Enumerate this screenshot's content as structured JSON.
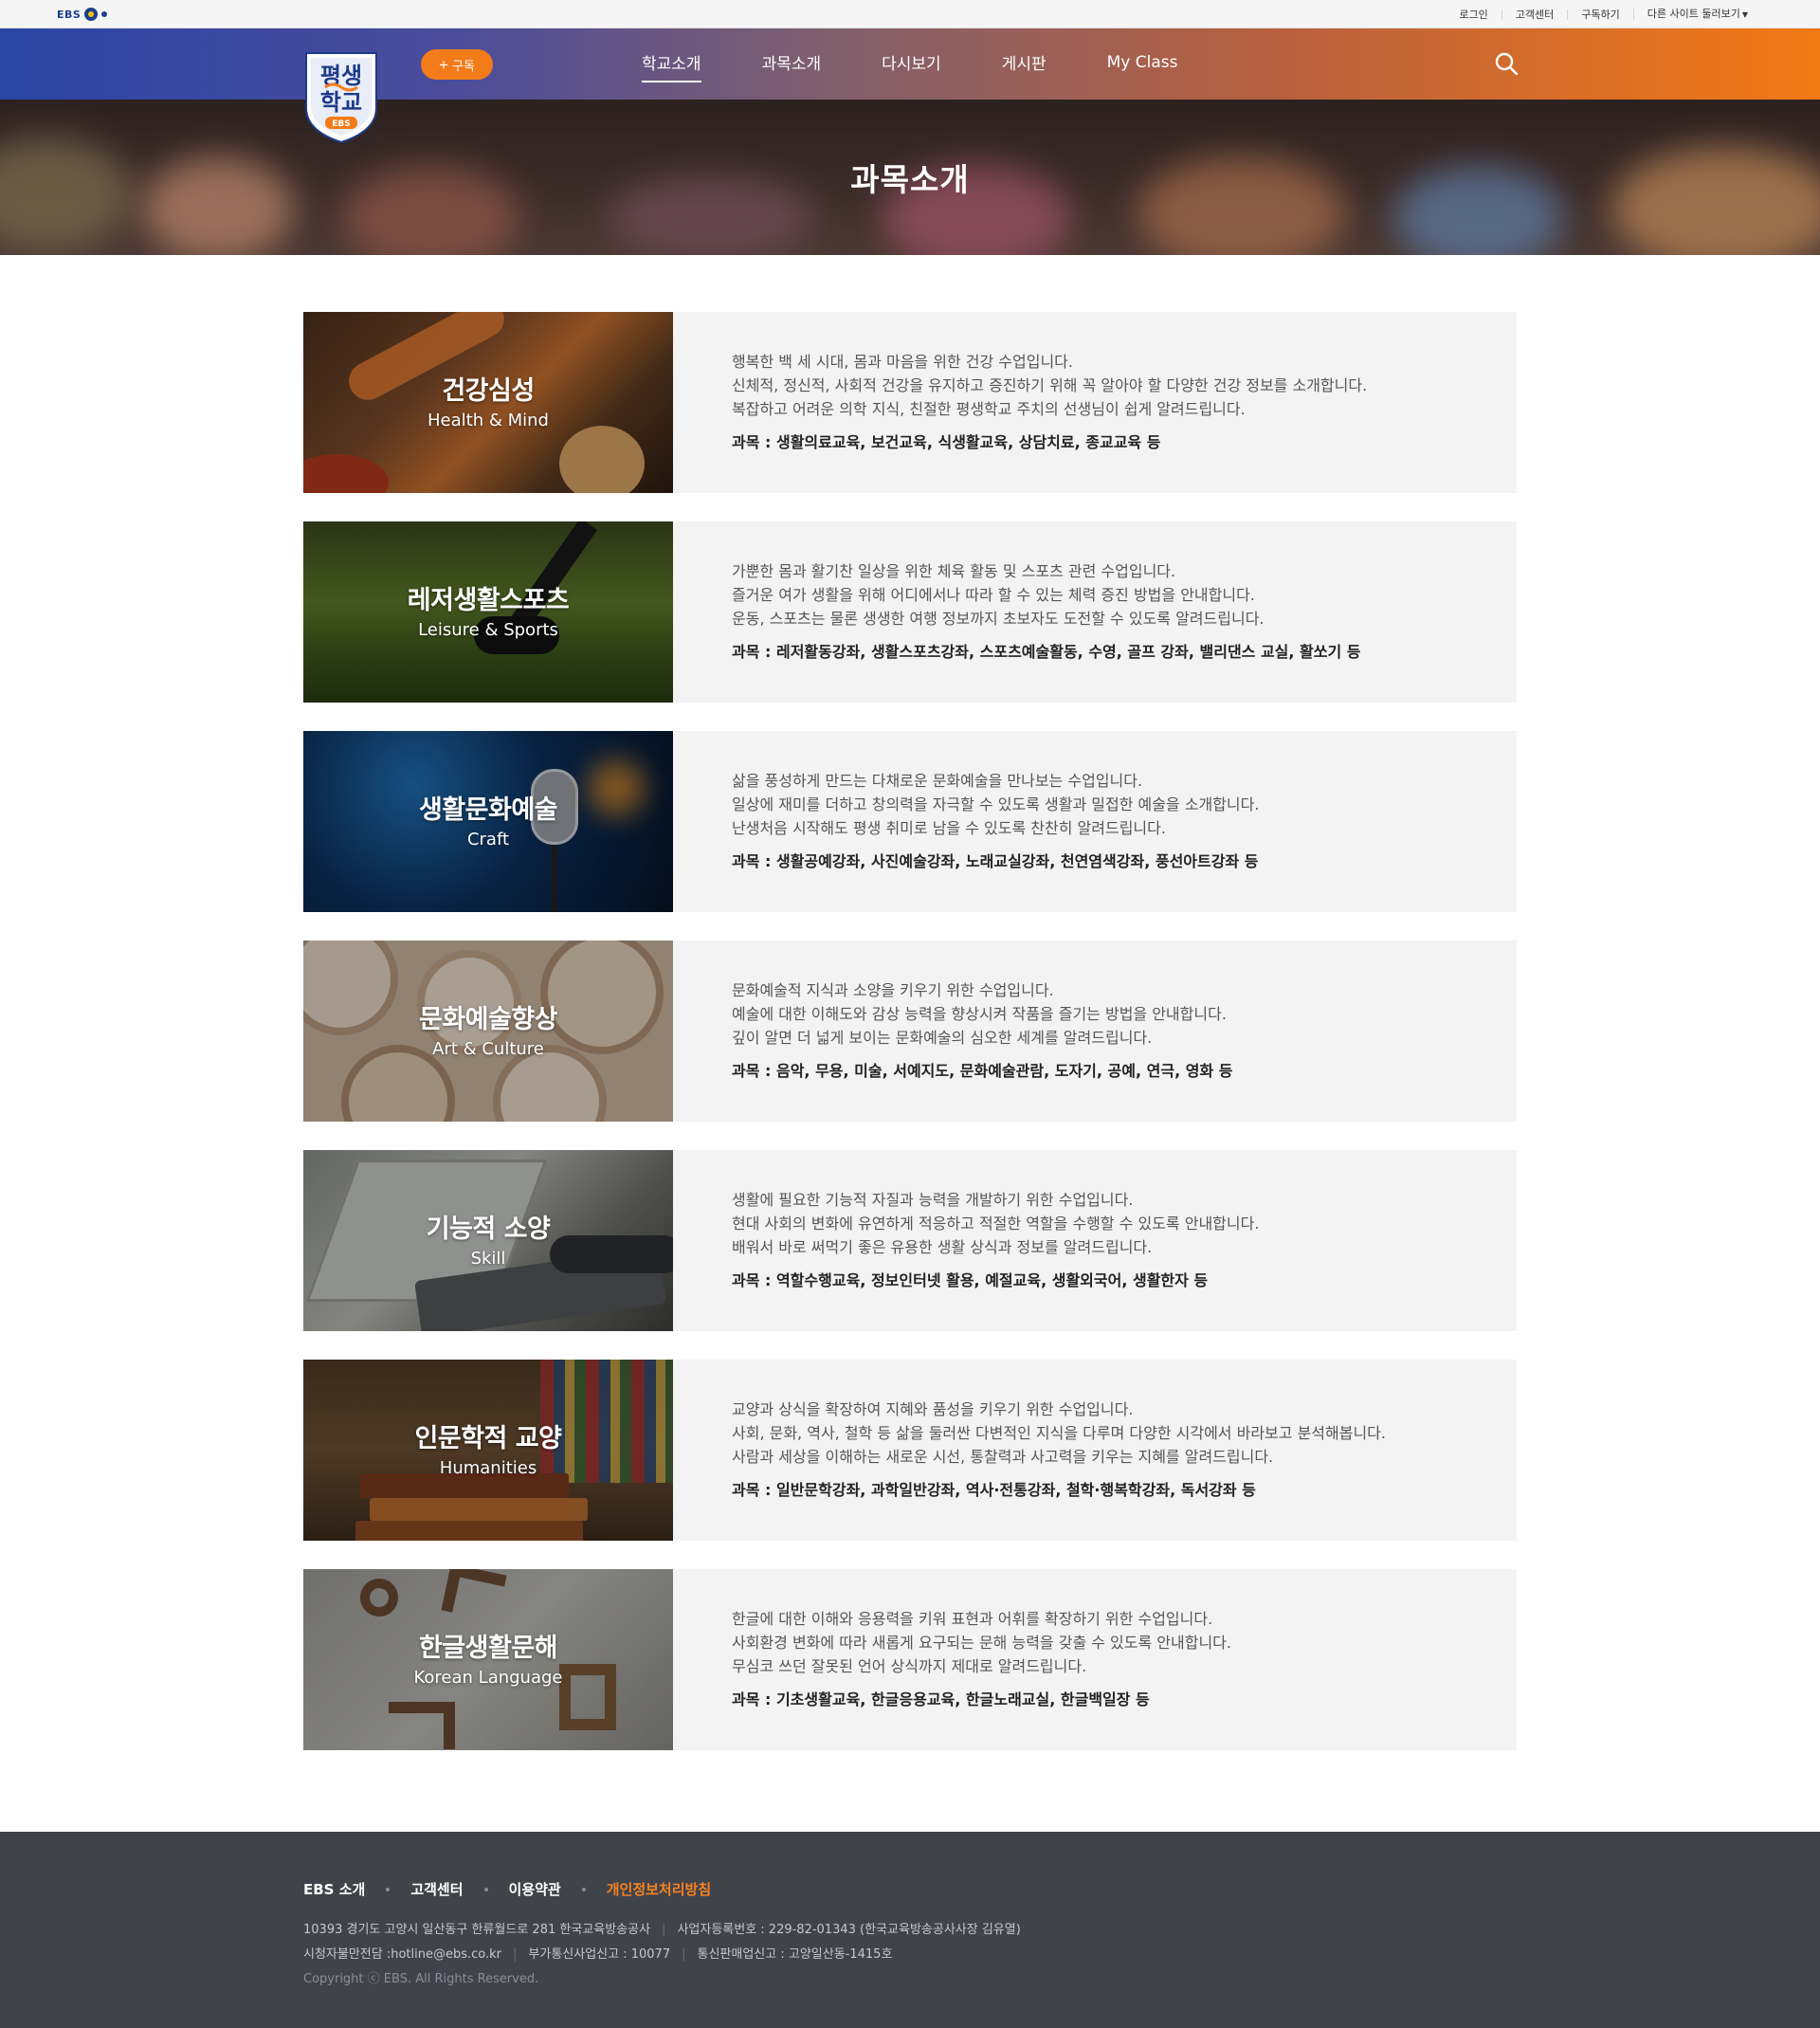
{
  "util": {
    "brand": "EBS",
    "links": [
      "로그인",
      "고객센터",
      "구독하기",
      "다른 사이트 둘러보기"
    ]
  },
  "header": {
    "logo_text_line1": "평생",
    "logo_text_line2": "학교",
    "logo_badge": "EBS",
    "subscribe_label": "구독",
    "nav": [
      "학교소개",
      "과목소개",
      "다시보기",
      "게시판",
      "My Class"
    ],
    "active_nav": "학교소개"
  },
  "hero": {
    "title": "과목소개"
  },
  "subjects": [
    {
      "title_ko": "건강심성",
      "title_en": "Health & Mind",
      "lines": [
        "행복한 백 세 시대, 몸과 마음을 위한 건강 수업입니다.",
        "신체적, 정신적, 사회적 건강을 유지하고 증진하기 위해 꼭 알아야 할 다양한 건강 정보를 소개합니다.",
        "복잡하고 어려운 의학 지식, 친절한 평생학교 주치의 선생님이 쉽게 알려드립니다."
      ],
      "courses": "과목 : 생활의료교육, 보건교육, 식생활교육, 상담치료, 종교교육 등"
    },
    {
      "title_ko": "레저생활스포츠",
      "title_en": "Leisure & Sports",
      "lines": [
        "가뿐한 몸과 활기찬 일상을 위한 체육 활동 및 스포츠 관련 수업입니다.",
        "즐거운 여가 생활을 위해 어디에서나 따라 할 수 있는 체력 증진 방법을 안내합니다.",
        "운동, 스포츠는 물론 생생한 여행 정보까지 초보자도 도전할 수 있도록 알려드립니다."
      ],
      "courses": "과목 : 레저활동강좌, 생활스포츠강좌, 스포츠예술활동, 수영, 골프 강좌, 밸리댄스 교실, 활쏘기 등"
    },
    {
      "title_ko": "생활문화예술",
      "title_en": "Craft",
      "lines": [
        "삶을 풍성하게 만드는 다채로운 문화예술을 만나보는 수업입니다.",
        "일상에 재미를 더하고 창의력을 자극할 수 있도록 생활과 밀접한 예술을 소개합니다.",
        "난생처음 시작해도 평생 취미로 남을 수 있도록 찬찬히 알려드립니다."
      ],
      "courses": "과목 : 생활공예강좌, 사진예술강좌, 노래교실강좌, 천연염색강좌, 풍선아트강좌 등"
    },
    {
      "title_ko": "문화예술향상",
      "title_en": "Art & Culture",
      "lines": [
        "문화예술적 지식과 소양을 키우기 위한 수업입니다.",
        "예술에 대한 이해도와 감상 능력을 향상시켜 작품을 즐기는 방법을 안내합니다.",
        "깊이 알면 더 넓게 보이는 문화예술의 심오한 세계를 알려드립니다."
      ],
      "courses": "과목 : 음악, 무용, 미술, 서예지도, 문화예술관람, 도자기, 공예, 연극, 영화 등"
    },
    {
      "title_ko": "기능적 소양",
      "title_en": "Skill",
      "lines": [
        "생활에 필요한 기능적 자질과 능력을 개발하기 위한 수업입니다.",
        "현대 사회의 변화에 유연하게 적응하고 적절한 역할을 수행할 수 있도록 안내합니다.",
        "배워서 바로 써먹기 좋은 유용한 생활 상식과 정보를 알려드립니다."
      ],
      "courses": "과목 : 역할수행교육, 정보인터넷 활용, 예절교육, 생활외국어, 생활한자 등"
    },
    {
      "title_ko": "인문학적 교양",
      "title_en": "Humanities",
      "lines": [
        "교양과 상식을 확장하여 지혜와 품성을 키우기 위한 수업입니다.",
        "사회, 문화, 역사, 철학 등 삶을 둘러싼 다변적인 지식을 다루며 다양한 시각에서 바라보고 분석해봅니다.",
        "사람과 세상을 이해하는 새로운 시선, 통찰력과 사고력을 키우는 지혜를 알려드립니다."
      ],
      "courses": "과목 : 일반문학강좌, 과학일반강좌, 역사·전통강좌, 철학·행복학강좌, 독서강좌 등"
    },
    {
      "title_ko": "한글생활문해",
      "title_en": "Korean Language",
      "lines": [
        "한글에 대한 이해와 응용력을 키워 표현과 어휘를 확장하기 위한 수업입니다.",
        "사회환경 변화에 따라 새롭게 요구되는 문해 능력을 갖출 수 있도록 안내합니다.",
        "무심코 쓰던 잘못된 언어 상식까지 제대로 알려드립니다."
      ],
      "courses": "과목 : 기초생활교육, 한글응용교육, 한글노래교실, 한글백일장 등"
    }
  ],
  "footer": {
    "links": [
      "EBS 소개",
      "고객센터",
      "이용약관",
      "개인정보처리방침"
    ],
    "address": "10393 경기도 고양시 일산동구 한류월드로 281 한국교육방송공사",
    "biz_no": "사업자등록번호 : 229-82-01343 (한국교육방송공사사장 김유열)",
    "hotline": "시청자불만전담 :hotline@ebs.co.kr",
    "telecom": "부가통신사업신고 : 10077",
    "mail_order": "통신판매업신고 : 고양일산동-1415호",
    "copyright": "Copyright ⓒ EBS. All Rights Reserved."
  },
  "colors": {
    "nav_gradient_start": "#2a45a4",
    "nav_gradient_end": "#f37914",
    "accent_orange": "#f47b19",
    "footer_bg": "#41434b",
    "card_bg": "#f3f3f3"
  }
}
